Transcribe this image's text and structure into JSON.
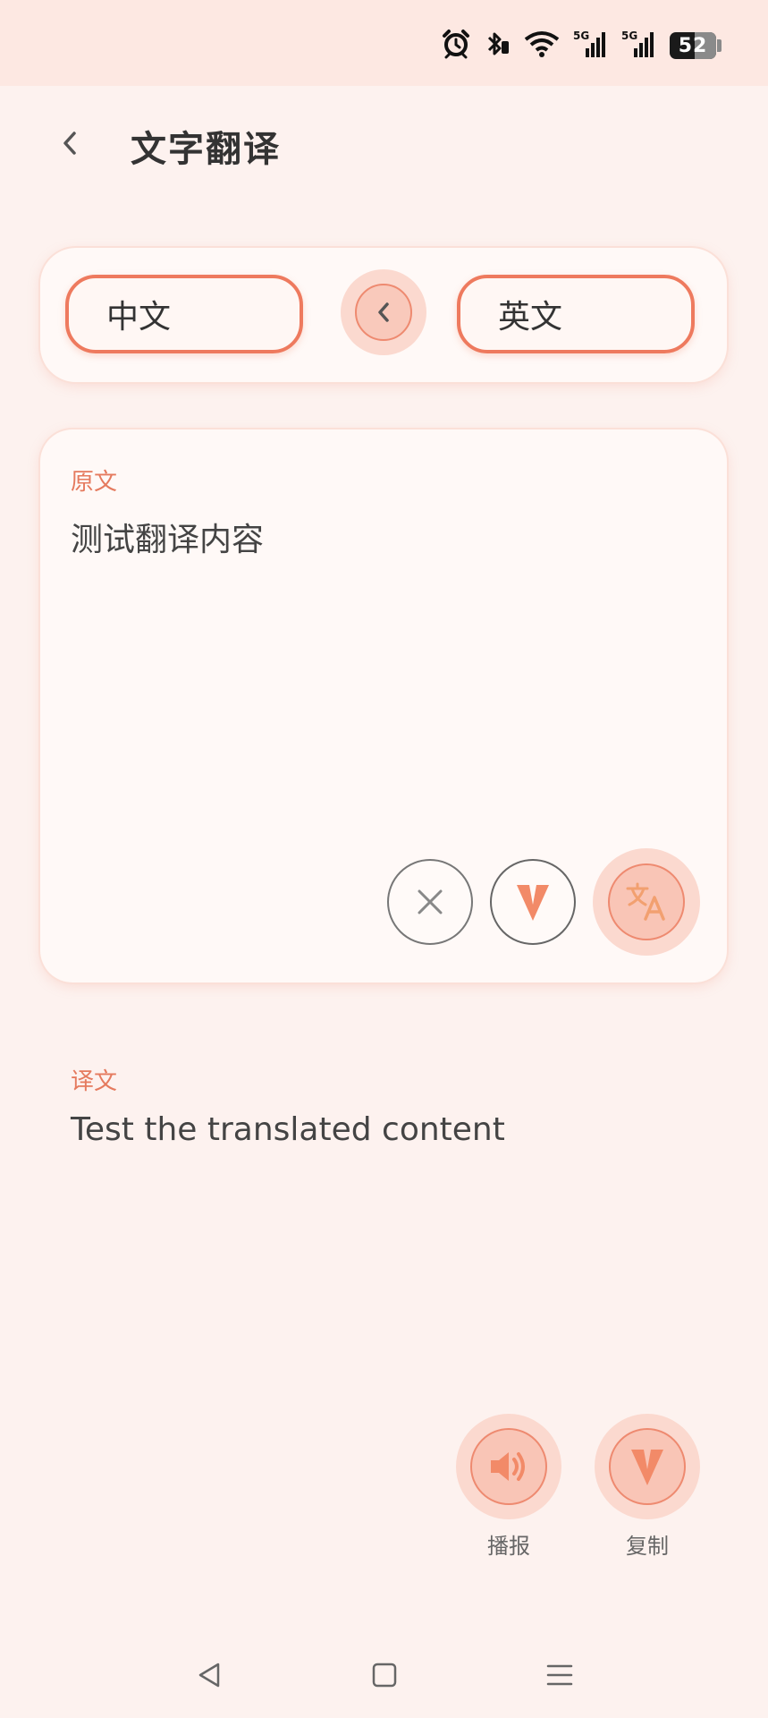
{
  "status_bar": {
    "battery_level": "52",
    "signal_label_1": "5G",
    "signal_label_2": "5G",
    "icons": [
      "alarm-icon",
      "bluetooth-icon",
      "wifi-icon",
      "signal-5g-icon",
      "signal-5g-icon",
      "battery-icon"
    ]
  },
  "header": {
    "title": "文字翻译",
    "back_icon": "chevron-left-icon"
  },
  "languages": {
    "source": "中文",
    "target": "英文",
    "swap_icon": "chevron-left-icon"
  },
  "source_panel": {
    "label": "原文",
    "text": "测试翻译内容",
    "buttons": {
      "clear_icon": "close-icon",
      "paste_icon": "v-logo-icon",
      "translate_icon": "translate-icon"
    }
  },
  "result_panel": {
    "label": "译文",
    "text": "Test the translated content"
  },
  "actions": {
    "speak_label": "播报",
    "copy_label": "复制"
  },
  "nav": {
    "icons": [
      "nav-back-icon",
      "nav-home-icon",
      "nav-menu-icon"
    ]
  },
  "colors": {
    "accent": "#ee7a5e",
    "background": "#fdf2ef",
    "card": "#fff9f7"
  }
}
